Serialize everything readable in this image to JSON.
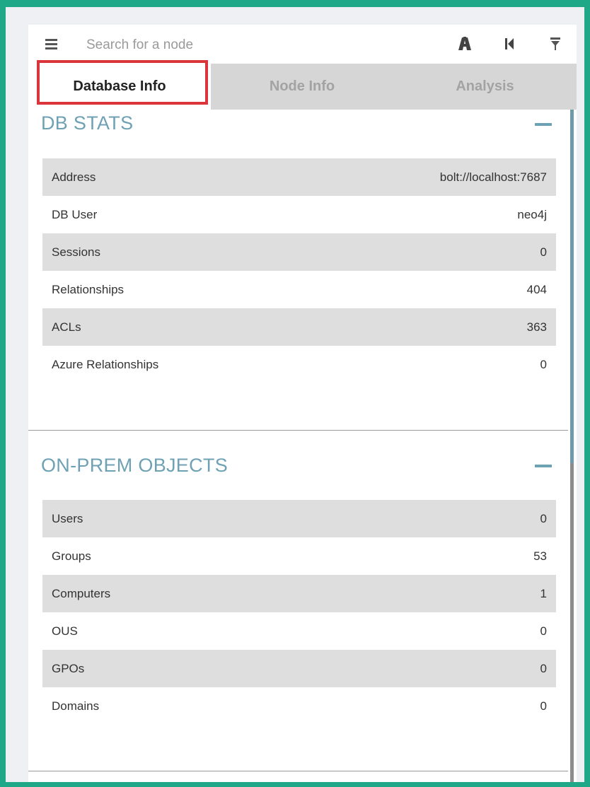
{
  "search": {
    "placeholder": "Search for a node",
    "value": ""
  },
  "toolbar": {
    "icons": [
      "pathfinding-icon",
      "back-icon",
      "filter-icon"
    ]
  },
  "tabs": [
    {
      "label": "Database Info",
      "active": true
    },
    {
      "label": "Node Info",
      "active": false
    },
    {
      "label": "Analysis",
      "active": false
    }
  ],
  "sections": {
    "db_stats": {
      "title": "DB STATS",
      "rows": [
        {
          "label": "Address",
          "value": "bolt://localhost:7687"
        },
        {
          "label": "DB User",
          "value": "neo4j"
        },
        {
          "label": "Sessions",
          "value": "0"
        },
        {
          "label": "Relationships",
          "value": "404"
        },
        {
          "label": "ACLs",
          "value": "363"
        },
        {
          "label": "Azure Relationships",
          "value": "0"
        }
      ]
    },
    "on_prem": {
      "title": "ON-PREM OBJECTS",
      "rows": [
        {
          "label": "Users",
          "value": "0"
        },
        {
          "label": "Groups",
          "value": "53"
        },
        {
          "label": "Computers",
          "value": "1"
        },
        {
          "label": "OUS",
          "value": "0"
        },
        {
          "label": "GPOs",
          "value": "0"
        },
        {
          "label": "Domains",
          "value": "0"
        }
      ]
    }
  },
  "colors": {
    "frame": "#1ea888",
    "section_title": "#6fa1b5",
    "highlight": "#d9353a",
    "row_shade": "#dedede"
  }
}
